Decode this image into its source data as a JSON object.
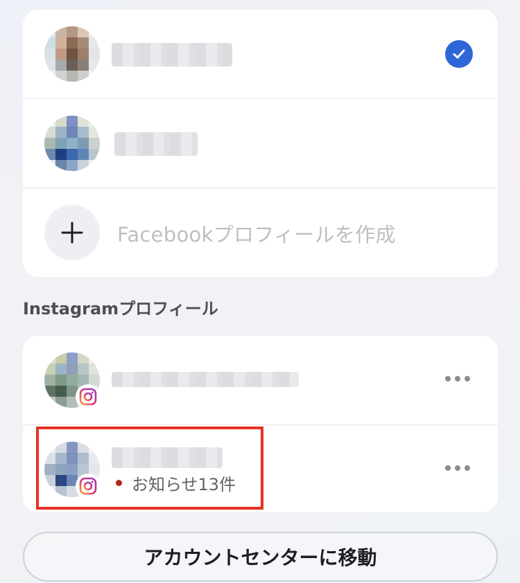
{
  "facebook_profiles": {
    "items": [
      {
        "selected": true
      },
      {
        "selected": false
      }
    ],
    "create_label": "Facebookプロフィールを作成"
  },
  "instagram_section": {
    "title": "Instagramプロフィール",
    "items": [
      {
        "notification": null
      },
      {
        "notification": "お知らせ13件"
      }
    ]
  },
  "accounts_center_button": "アカウントセンターに移動",
  "colors": {
    "accent": "#2e66d8",
    "highlight_box": "#e53224",
    "notification_dot": "#b3261e"
  },
  "icons": [
    "check-icon",
    "plus-icon",
    "instagram-icon",
    "more-icon"
  ]
}
